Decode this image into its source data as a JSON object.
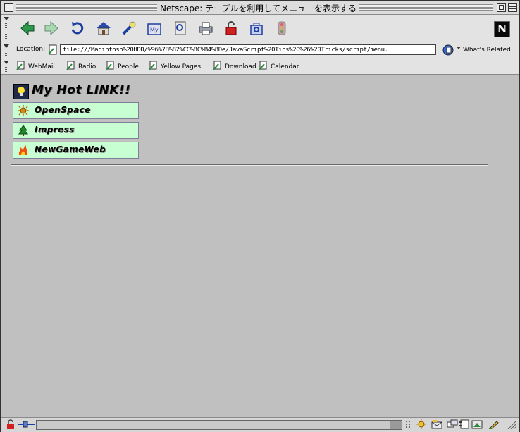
{
  "window": {
    "title": "Netscape: テーブルを利用してメニューを表示する"
  },
  "toolbar": {
    "buttons": [
      {
        "name": "back-button"
      },
      {
        "name": "forward-button"
      },
      {
        "name": "reload-button"
      },
      {
        "name": "home-button"
      },
      {
        "name": "search-button"
      },
      {
        "name": "my-netscape-button"
      },
      {
        "name": "images-button"
      },
      {
        "name": "print-button"
      },
      {
        "name": "security-button"
      },
      {
        "name": "shop-button"
      },
      {
        "name": "stop-button"
      }
    ],
    "my_label": "My"
  },
  "location": {
    "label": "Location:",
    "url": "file:///Macintosh%20HDD/%96%7B%82%CC%8C%B4%8De/JavaScript%20Tips%20%26%20Tricks/script/menu.",
    "related": "What's Related"
  },
  "personal_toolbar": {
    "items": [
      {
        "label": "WebMail"
      },
      {
        "label": "Radio"
      },
      {
        "label": "People"
      },
      {
        "label": "Yellow Pages"
      },
      {
        "label": "Download"
      },
      {
        "label": "Calendar"
      }
    ]
  },
  "page": {
    "heading": "My Hot LINK!!",
    "links": [
      {
        "label": "OpenSpace",
        "icon": "sun-icon"
      },
      {
        "label": "Impress",
        "icon": "tree-icon"
      },
      {
        "label": "NewGameWeb",
        "icon": "flame-icon"
      }
    ]
  },
  "colors": {
    "link_bg": "#c8ffd2",
    "page_bg": "#c0c0c0"
  }
}
